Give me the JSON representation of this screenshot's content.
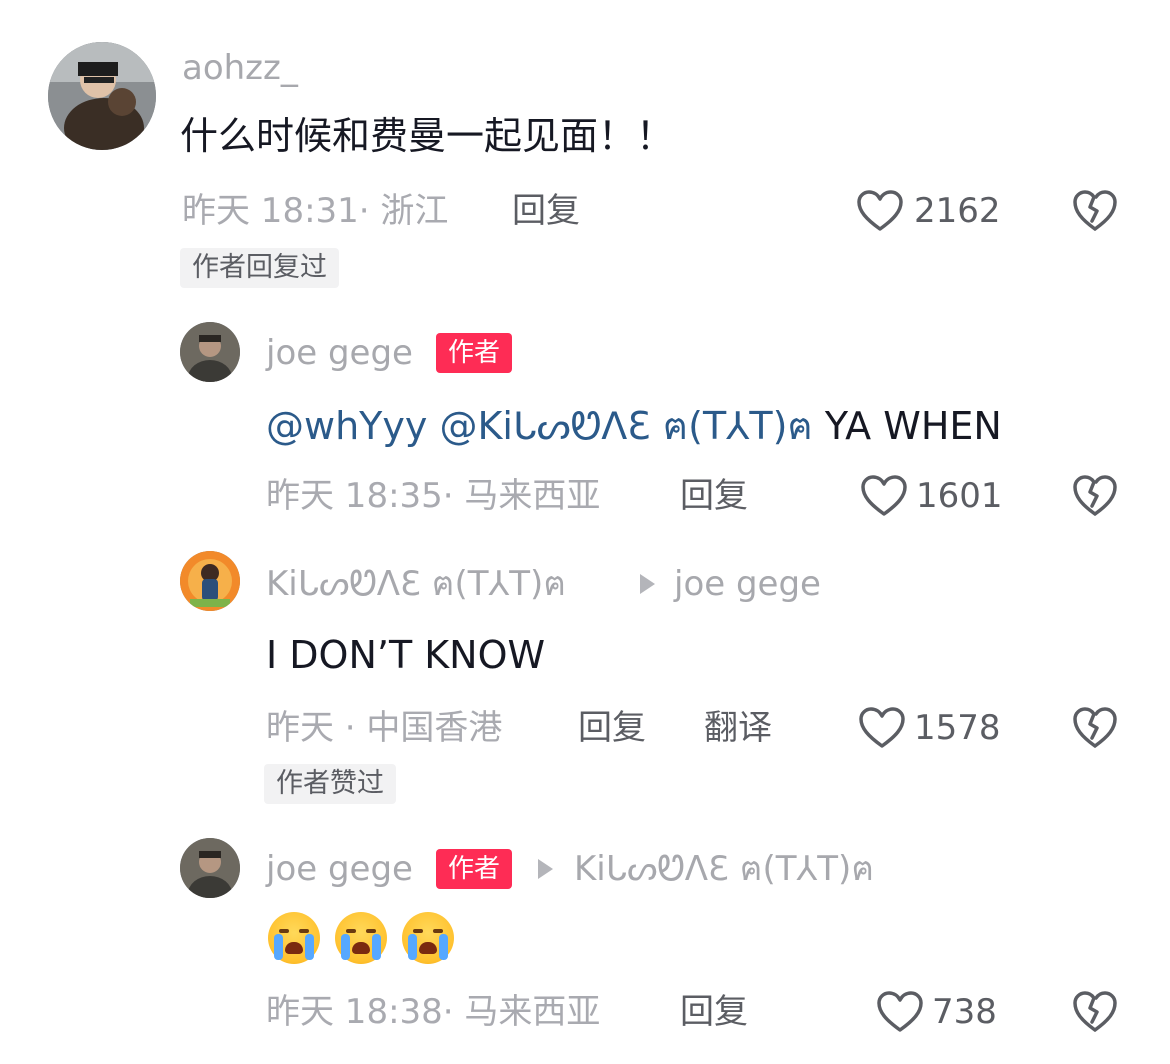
{
  "comments": [
    {
      "user": "aohzz_",
      "text": "什么时候和费曼一起见面！！",
      "time": "昨天 18:31· 浙江",
      "reply_label": "回复",
      "likes": "2162",
      "tag": "作者回复过"
    },
    {
      "user": "joe gege",
      "badge": "作者",
      "mention1": "@whYyy",
      "mention2": "@KiᒐᔕᏬᐱƐ ฅ(T⅄T)ฅ",
      "text_rest": "YA WHEN",
      "time": "昨天 18:35· 马来西亚",
      "reply_label": "回复",
      "likes": "1601"
    },
    {
      "user": "KiᒐᔕᏬᐱƐ ฅ(T⅄T)ฅ",
      "reply_to": "joe gege",
      "text": "I DON’T KNOW",
      "time": "昨天 · 中国香港",
      "reply_label": "回复",
      "translate_label": "翻译",
      "likes": "1578",
      "tag": "作者赞过"
    },
    {
      "user": "joe gege",
      "badge": "作者",
      "reply_to": "KiᒐᔕᏬᐱƐ ฅ(T⅄T)ฅ",
      "emojis": [
        "loudly-crying-face",
        "loudly-crying-face",
        "loudly-crying-face"
      ],
      "time": "昨天 18:38· 马来西亚",
      "reply_label": "回复",
      "likes": "738"
    }
  ],
  "colors": {
    "author_badge": "#fe2c55",
    "mention": "#2b5a8a",
    "meta": "#a9aab0"
  }
}
